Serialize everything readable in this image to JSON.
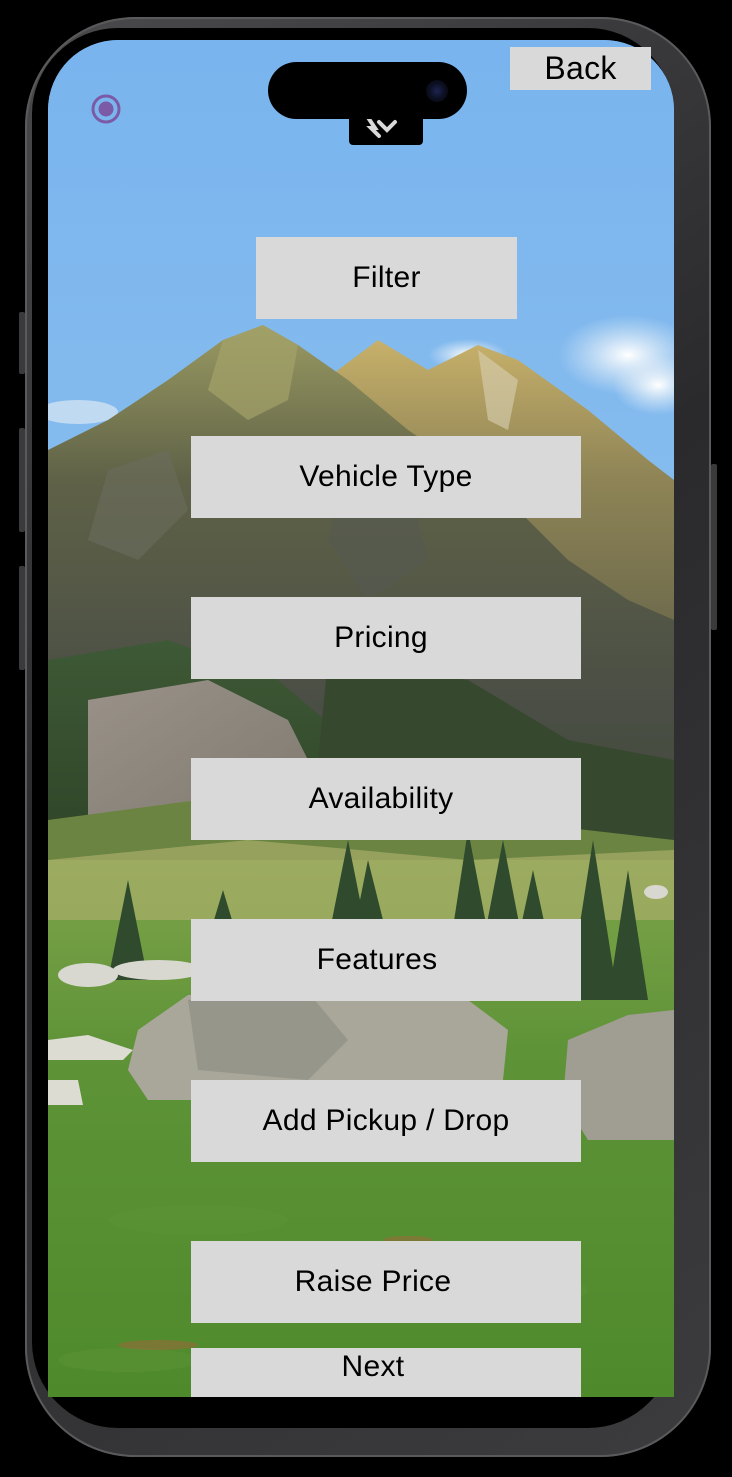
{
  "header": {
    "back_label": "Back"
  },
  "menu": {
    "filter_label": "Filter",
    "items": [
      {
        "label": "Vehicle Type"
      },
      {
        "label": "Pricing"
      },
      {
        "label": "Availability"
      },
      {
        "label": "Features"
      },
      {
        "label": "Add Pickup / Drop"
      },
      {
        "label": "Raise Price"
      }
    ],
    "next_label": "Next"
  },
  "icons": {
    "status": "radio-icon",
    "logo": "app-logo-icon"
  },
  "colors": {
    "button_bg": "#d9d9d9",
    "button_text": "#000000",
    "radio_accent": "#7b5aa6",
    "device_frame": "#2f2f31"
  }
}
